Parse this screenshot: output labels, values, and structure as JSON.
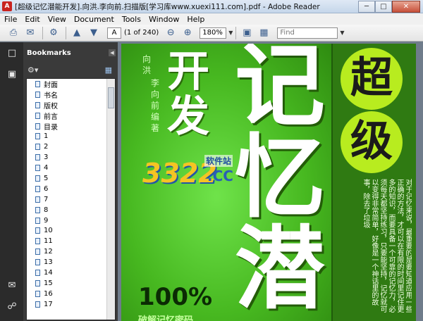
{
  "window": {
    "title": "[超级记忆潜能开发].向洪.李向前.扫描版[学习库www.xuexi111.com].pdf - Adobe Reader",
    "minimize": "─",
    "maximize": "□",
    "close": "✕"
  },
  "menu": [
    "File",
    "Edit",
    "View",
    "Document",
    "Tools",
    "Window",
    "Help"
  ],
  "toolbar": {
    "page_current": "A",
    "page_of": "(1 of 240)",
    "zoom": "180%",
    "find_placeholder": "Find"
  },
  "bookmarks": {
    "title": "Bookmarks",
    "items": [
      "封面",
      "书名",
      "版权",
      "前言",
      "目录",
      "1",
      "2",
      "3",
      "4",
      "5",
      "6",
      "7",
      "8",
      "9",
      "10",
      "11",
      "12",
      "13",
      "14",
      "15",
      "16",
      "17"
    ]
  },
  "cover": {
    "author1": "向洪",
    "author2": "李向前",
    "author_suffix": "编著",
    "word_kaifa": "开发",
    "circle1": "超",
    "circle2": "级",
    "word_jiyi": "记忆",
    "word_qian": "潜",
    "side_text": "对于记忆来说，最重要的是要知道应用一些正确的方法，才可以在有限的时间里记住更多的知识，而要具备一个可靠的记忆力，必须每天都坚持练习，只要能坚持，记忆就可以变得非常简单，好像是一个神话里的故事，除去了垃圾",
    "percent": "100%",
    "bottom": "破解记忆密码"
  },
  "watermark": {
    "number": "3322",
    "cn": "软件站",
    "cc": ".CC"
  },
  "colors": {
    "cover_green": "#47b820",
    "circle_lime": "#b8ec1f",
    "panel_dark": "#3a3a3a"
  }
}
